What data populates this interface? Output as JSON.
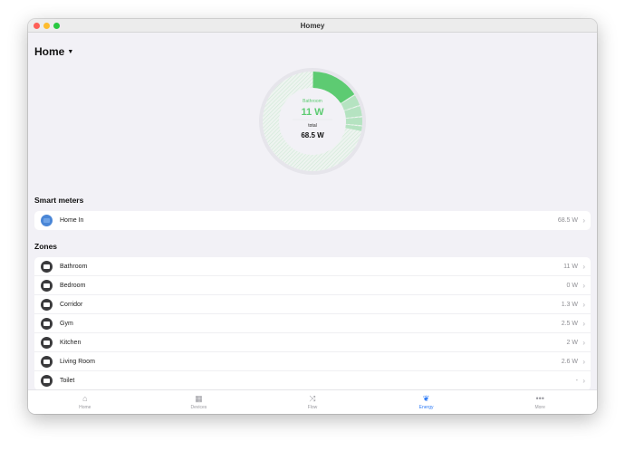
{
  "window": {
    "title": "Homey"
  },
  "header": {
    "title": "Home"
  },
  "summary": {
    "zone_label": "Bathroom",
    "zone_value": "11 W",
    "total_label": "total",
    "total_value": "68.5 W"
  },
  "chart_data": {
    "type": "pie",
    "total": 68.5,
    "highlight": "Bathroom",
    "segments": [
      {
        "name": "Bathroom",
        "value": 11
      },
      {
        "name": "Living Room",
        "value": 2.6
      },
      {
        "name": "Gym",
        "value": 2.5
      },
      {
        "name": "Kitchen",
        "value": 2
      },
      {
        "name": "Corridor",
        "value": 1.3
      }
    ]
  },
  "smart_meters": {
    "heading": "Smart meters",
    "items": [
      {
        "label": "Home In",
        "value": "68.5 W"
      }
    ]
  },
  "zones": {
    "heading": "Zones",
    "items": [
      {
        "label": "Bathroom",
        "value": "11 W"
      },
      {
        "label": "Bedroom",
        "value": "0 W"
      },
      {
        "label": "Corridor",
        "value": "1.3 W"
      },
      {
        "label": "Gym",
        "value": "2.5 W"
      },
      {
        "label": "Kitchen",
        "value": "2 W"
      },
      {
        "label": "Living Room",
        "value": "2.6 W"
      },
      {
        "label": "Toilet",
        "value": "-"
      }
    ]
  },
  "tabs": [
    {
      "label": "Home",
      "icon": "⌂"
    },
    {
      "label": "Devices",
      "icon": "▦"
    },
    {
      "label": "Flow",
      "icon": "⤨"
    },
    {
      "label": "Energy",
      "icon": "❦"
    },
    {
      "label": "More",
      "icon": "•••"
    }
  ],
  "colors": {
    "accent": "#2f7cf6",
    "green": "#5dcb72",
    "green_light": "#b5e3c1"
  }
}
